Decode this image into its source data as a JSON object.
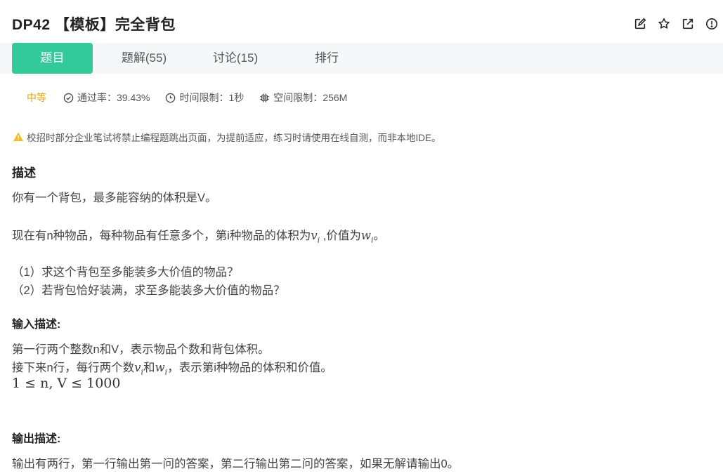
{
  "header": {
    "title": "DP42 【模板】完全背包",
    "icons": [
      "edit-icon",
      "star-icon",
      "external-link-icon",
      "info-icon"
    ]
  },
  "tabs": [
    {
      "label": "题目",
      "active": true
    },
    {
      "label": "题解(55)",
      "active": false
    },
    {
      "label": "讨论(15)",
      "active": false
    },
    {
      "label": "排行",
      "active": false
    }
  ],
  "meta": {
    "difficulty": "中等",
    "pass_rate": "通过率：39.43%",
    "time_limit": "时间限制：1秒",
    "space_limit": "空间限制：256M"
  },
  "colors": {
    "accent": "#32ca99",
    "difficulty": "#e2a50b",
    "warning": "#f5b921"
  },
  "warning_text": "校招时部分企业笔试将禁止编程题跳出页面，为提前适应，练习时请使用在线自测，而非本地IDE。",
  "description": {
    "title": "描述",
    "line1": "你有一个背包，最多能容纳的体积是V。",
    "line2_prefix": "现在有n种物品，每种物品有任意多个，第i种物品的体积为",
    "line2_v": "v",
    "line2_v_sub": "i",
    "line2_mid": " ,价值为",
    "line2_w": "w",
    "line2_w_sub": "i",
    "line2_suffix": "。",
    "q1": "（1）求这个背包至多能装多大价值的物品？",
    "q2": "（2）若背包恰好装满，求至多能装多大价值的物品？"
  },
  "input": {
    "title": "输入描述:",
    "line1": "第一行两个整数n和V，表示物品个数和背包体积。",
    "line2_prefix": "接下来n行，每行两个数",
    "line2_v": "v",
    "line2_v_sub": "i",
    "line2_mid": "和",
    "line2_w": "w",
    "line2_w_sub": "i",
    "line2_suffix": "，表示第i种物品的体积和价值。",
    "constraint": "1 ≤ n, V ≤ 1000"
  },
  "output": {
    "title": "输出描述:",
    "line1": "输出有两行，第一行输出第一问的答案，第二行输出第二问的答案，如果无解请输出0。"
  }
}
